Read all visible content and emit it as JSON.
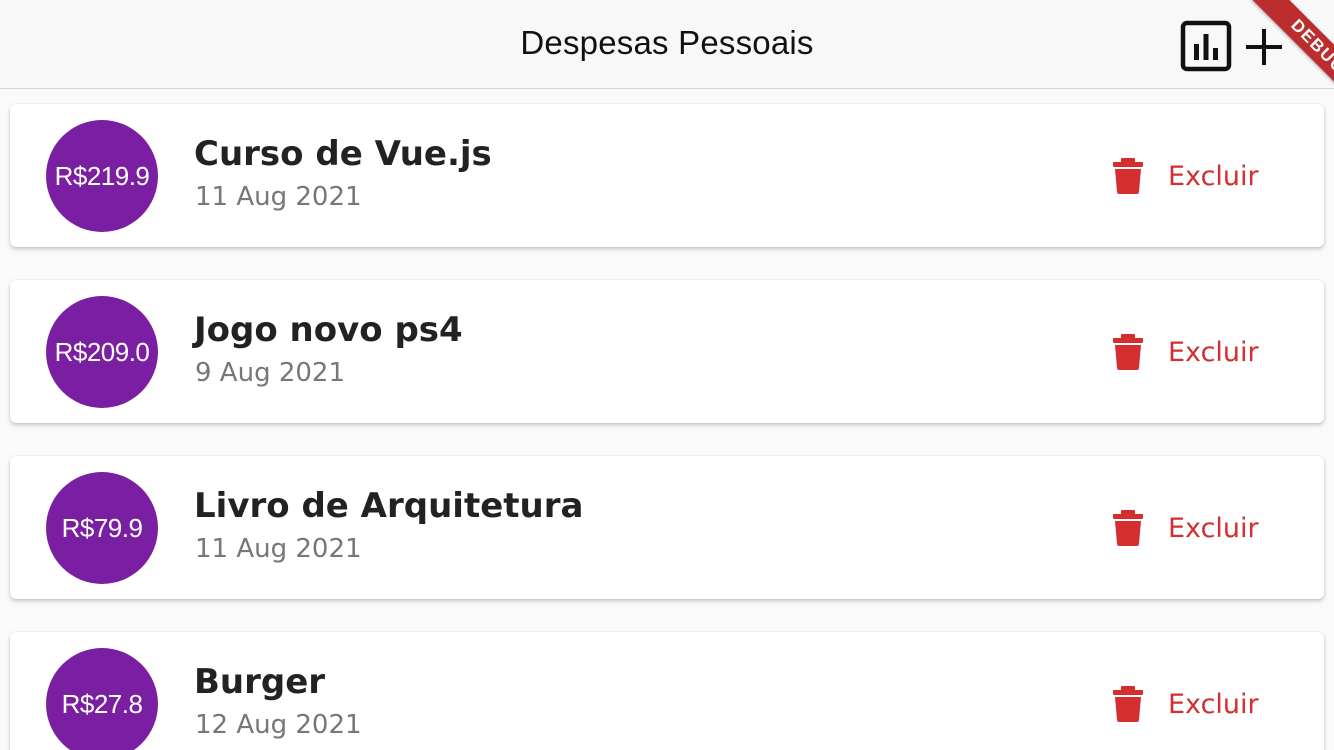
{
  "app_bar": {
    "title": "Despesas Pessoais",
    "chart_icon": "bar-chart-icon",
    "add_icon": "add-icon"
  },
  "debug_banner": {
    "label": "DEBUG",
    "color": "#b71c1c"
  },
  "colors": {
    "avatar": "#7b1fa2",
    "delete": "#d32f2f",
    "title": "#222222",
    "date": "#777777"
  },
  "transactions": [
    {
      "amount": "R$219.9",
      "title": "Curso de Vue.js",
      "date": "11 Aug 2021",
      "delete_label": "Excluir",
      "delete_icon": "trash-icon"
    },
    {
      "amount": "R$209.0",
      "title": "Jogo novo ps4",
      "date": "9 Aug 2021",
      "delete_label": "Excluir",
      "delete_icon": "trash-icon"
    },
    {
      "amount": "R$79.9",
      "title": "Livro de Arquitetura",
      "date": "11 Aug 2021",
      "delete_label": "Excluir",
      "delete_icon": "trash-icon"
    },
    {
      "amount": "R$27.8",
      "title": "Burger",
      "date": "12 Aug 2021",
      "delete_label": "Excluir",
      "delete_icon": "trash-icon"
    }
  ]
}
